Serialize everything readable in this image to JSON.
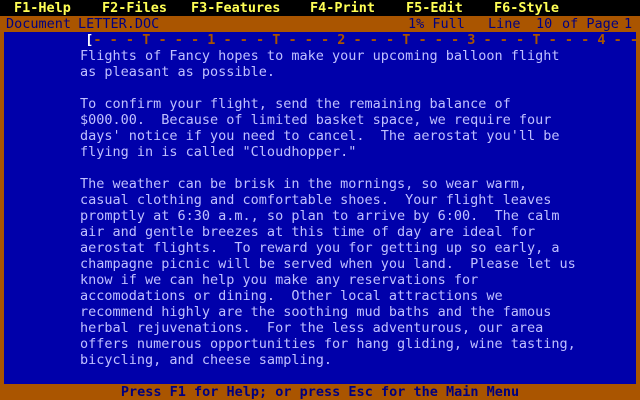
{
  "menubar": {
    "items": [
      "F1-Help",
      "F2-Files",
      "F3-Features",
      "F4-Print",
      "F5-Edit",
      "F6-Style"
    ]
  },
  "status": {
    "document_label": "Document",
    "filename": "LETTER.DOC",
    "full_indicator": "1% Full",
    "line_label": "Line",
    "line_number": "10",
    "page_label": "of Page",
    "page_number": "1"
  },
  "ruler": {
    "marker": "[",
    "text": "- - - T - - - 1 - - - T - - - 2 - - - T - - - 3 - - - T - - - 4 - - - T - - - 5 - - - T - - - 6 - - - T - - - ]"
  },
  "document": {
    "paragraphs": [
      "Flights of Fancy hopes to make your upcoming balloon flight\nas pleasant as possible.",
      "To confirm your flight, send the remaining balance of\n$000.00.  Because of limited basket space, we require four\ndays' notice if you need to cancel.  The aerostat you'll be\nflying in is called \"Cloudhopper.\"",
      "The weather can be brisk in the mornings, so wear warm,\ncasual clothing and comfortable shoes.  Your flight leaves\npromptly at 6:30 a.m., so plan to arrive by 6:00.  The calm\nair and gentle breezes at this time of day are ideal for\naerostat flights.  To reward you for getting up so early, a\nchampagne picnic will be served when you land.  Please let us\nknow if we can help you make any reservations for\naccomodations or dining.  Other local attractions we\nrecommend highly are the soothing mud baths and the famous\nherbal rejuvenations.  For the less adventurous, our area\noffers numerous opportunities for hang gliding, wine tasting,\nbicycling, and cheese sampling."
    ]
  },
  "helpbar": {
    "text": "Press F1 for Help; or press Esc for the Main Menu"
  },
  "colors": {
    "menubar_bg": "#000000",
    "menubar_text": "#FFFF55",
    "statusbar_bg": "#AA5500",
    "statusbar_text": "#000080",
    "document_bg": "#0000AA",
    "document_text": "#C0C0FF",
    "ruler_text": "#AA5500"
  }
}
